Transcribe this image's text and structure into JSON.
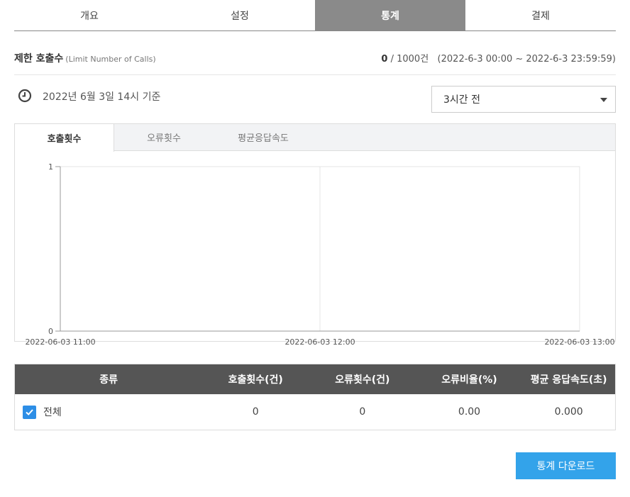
{
  "top_tabs": [
    {
      "label": "개요",
      "active": false
    },
    {
      "label": "설정",
      "active": false
    },
    {
      "label": "통계",
      "active": true
    },
    {
      "label": "결제",
      "active": false
    }
  ],
  "limit": {
    "title": "제한 호출수",
    "subtitle": "(Limit Number of Calls)",
    "used": "0",
    "rest": " / 1000건   (2022-6-3 00:00 ~ 2022-6-3 23:59:59)"
  },
  "base_time": "2022년 6월 3일 14시 기준",
  "period_select": {
    "value": "3시간 전"
  },
  "chart_tabs": [
    {
      "label": "호출횟수",
      "active": true
    },
    {
      "label": "오류횟수",
      "active": false
    },
    {
      "label": "평균응답속도",
      "active": false
    }
  ],
  "chart_data": {
    "type": "line",
    "x": [
      "2022-06-03 11:00",
      "2022-06-03 12:00",
      "2022-06-03 13:00"
    ],
    "y_ticks": [
      "0",
      "1"
    ],
    "ylim": [
      0,
      1
    ],
    "series": [],
    "grid": true
  },
  "table": {
    "headers": [
      "종류",
      "호출횟수(건)",
      "오류횟수(건)",
      "오류비율(%)",
      "평균 응답속도(초)"
    ],
    "rows": [
      {
        "type": "전체",
        "calls": "0",
        "errors": "0",
        "error_rate": "0.00",
        "avg_speed": "0.000",
        "checked": true
      }
    ]
  },
  "download_button": "통계 다운로드",
  "colors": {
    "accent": "#33a3ea",
    "checkbox": "#2d8ee6",
    "active_tab": "#8a8a8a",
    "table_header": "#555555"
  }
}
